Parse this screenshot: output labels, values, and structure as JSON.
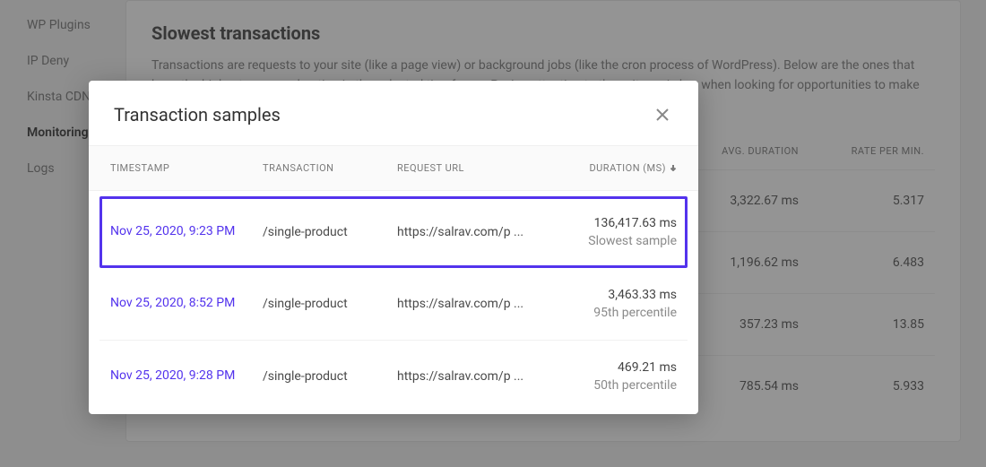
{
  "sidebar": {
    "items": [
      {
        "label": "WP Plugins",
        "active": false
      },
      {
        "label": "IP Deny",
        "active": false
      },
      {
        "label": "Kinsta CDN",
        "active": false
      },
      {
        "label": "Monitoring",
        "active": true
      },
      {
        "label": "Logs",
        "active": false
      }
    ]
  },
  "page": {
    "title": "Slowest transactions",
    "description": "Transactions are requests to your site (like a page view) or background jobs (like the cron process of WordPress). Below are the ones that have the highest average duration in the selected timeframe. Paying attention to these items is key when looking for opportunities to make your site faster."
  },
  "bg_table": {
    "headers": {
      "avg_duration": "AVG. DURATION",
      "rate": "RATE PER MIN."
    },
    "rows": [
      {
        "duration": "3,322.67 ms",
        "rate": "5.317"
      },
      {
        "duration": "1,196.62 ms",
        "rate": "6.483"
      },
      {
        "duration": "357.23 ms",
        "rate": "13.85"
      },
      {
        "duration": "785.54 ms",
        "rate": "5.933"
      }
    ]
  },
  "modal": {
    "title": "Transaction samples",
    "headers": {
      "timestamp": "TIMESTAMP",
      "transaction": "TRANSACTION",
      "request_url": "REQUEST URL",
      "duration": "DURATION (MS)"
    },
    "rows": [
      {
        "timestamp": "Nov 25, 2020, 9:23 PM",
        "transaction": "/single-product",
        "request_url": "https://salrav.com/p ...",
        "duration": "136,417.63 ms",
        "note": "Slowest sample",
        "selected": true
      },
      {
        "timestamp": "Nov 25, 2020, 8:52 PM",
        "transaction": "/single-product",
        "request_url": "https://salrav.com/p ...",
        "duration": "3,463.33 ms",
        "note": "95th percentile",
        "selected": false
      },
      {
        "timestamp": "Nov 25, 2020, 9:28 PM",
        "transaction": "/single-product",
        "request_url": "https://salrav.com/p ...",
        "duration": "469.21 ms",
        "note": "50th percentile",
        "selected": false
      }
    ]
  }
}
